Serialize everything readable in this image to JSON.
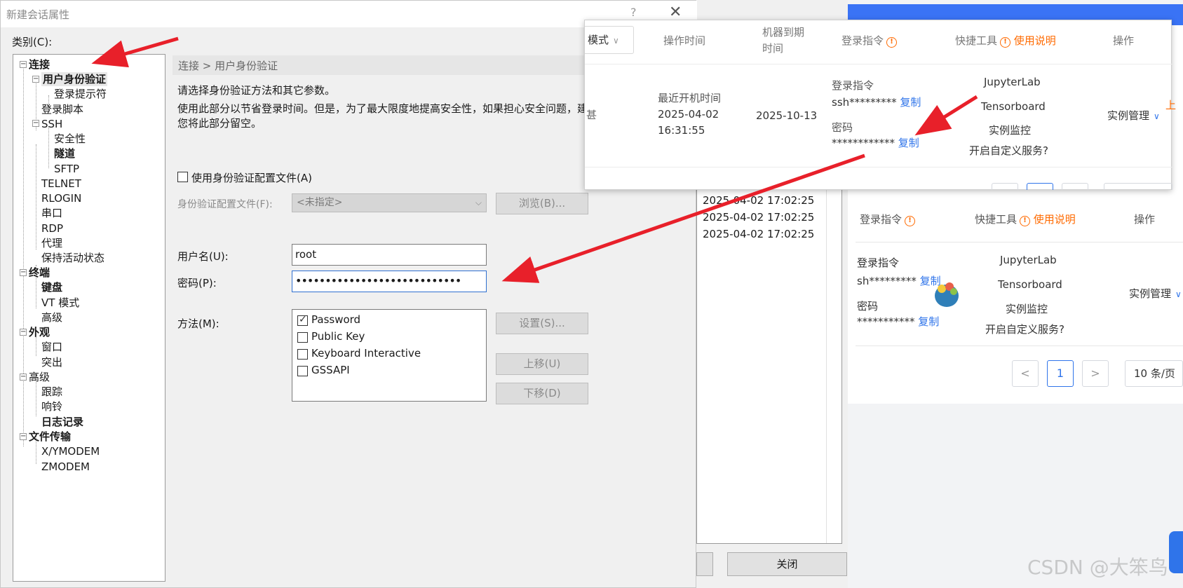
{
  "dialog": {
    "title": "新建会话属性",
    "help_icon": "?",
    "close_icon": "✕",
    "category_label": "类别(C):",
    "tree": [
      {
        "label": "连接",
        "bold": true
      },
      {
        "label": "用户身份验证",
        "bold": true
      },
      {
        "label": "登录提示符"
      },
      {
        "label": "登录脚本"
      },
      {
        "label": "SSH"
      },
      {
        "label": "安全性"
      },
      {
        "label": "隧道",
        "bold": true
      },
      {
        "label": "SFTP"
      },
      {
        "label": "TELNET"
      },
      {
        "label": "RLOGIN"
      },
      {
        "label": "串口"
      },
      {
        "label": "RDP"
      },
      {
        "label": "代理"
      },
      {
        "label": "保持活动状态"
      },
      {
        "label": "终端",
        "bold": true
      },
      {
        "label": "键盘",
        "bold": true
      },
      {
        "label": "VT 模式"
      },
      {
        "label": "高级"
      },
      {
        "label": "外观",
        "bold": true
      },
      {
        "label": "窗口"
      },
      {
        "label": "突出"
      },
      {
        "label": "高级"
      },
      {
        "label": "跟踪"
      },
      {
        "label": "响铃"
      },
      {
        "label": "日志记录",
        "bold": true
      },
      {
        "label": "文件传输",
        "bold": true
      },
      {
        "label": "X/YMODEM"
      },
      {
        "label": "ZMODEM"
      }
    ],
    "breadcrumb": "连接 > 用户身份验证",
    "desc1": "请选择身份验证方法和其它参数。",
    "desc2": "使用此部分以节省登录时间。但是，为了最大限度地提高安全性，如果担心安全问题，建议您将此部分留空。",
    "use_profile_label": "使用身份验证配置文件(A)",
    "profile_file_label": "身份验证配置文件(F):",
    "profile_file_value": "<未指定>",
    "browse_button": "浏览(B)...",
    "username_label": "用户名(U):",
    "username_value": "root",
    "password_label": "密码(P):",
    "password_value": "••••••••••••••••••••••••••••",
    "method_label": "方法(M):",
    "methods": [
      {
        "label": "Password",
        "checked": true
      },
      {
        "label": "Public Key",
        "checked": false
      },
      {
        "label": "Keyboard Interactive",
        "checked": false
      },
      {
        "label": "GSSAPI",
        "checked": false
      }
    ],
    "settings_button": "设置(S)...",
    "move_up_button": "上移(U)",
    "move_down_button": "下移(D)"
  },
  "mid_window": {
    "timestamps": [
      "2025-04-02 17:02:25",
      "2025-04-02 17:02:25",
      "2025-04-02 17:02:25"
    ],
    "close_button": "关闭"
  },
  "popup": {
    "mode_select": "模式",
    "col_op_time": "操作时间",
    "col_expire_line1": "机器到期",
    "col_expire_line2": "时间",
    "col_login_cmd": "登录指令",
    "col_tools": "快捷工具",
    "usage_link": "使用说明",
    "col_actions": "操作",
    "partial_char": "甚",
    "last_boot_label": "最近开机时间",
    "last_boot_date": "2025-04-02",
    "last_boot_time": "16:31:55",
    "expire_date": "2025-10-13",
    "login_cmd_label": "登录指令",
    "login_cmd_value": "ssh*********",
    "copy1": "复制",
    "password_label": "密码",
    "password_value": "************",
    "copy2": "复制",
    "tool_jupyter": "JupyterLab",
    "tool_tensorboard": "Tensorboard",
    "tool_monitor": "实例监控",
    "tool_custom": "开启自定义服务?",
    "manage": "实例管理",
    "edge_char": "上"
  },
  "background_page": {
    "col_login_cmd": "登录指令",
    "col_tools": "快捷工具",
    "usage_link": "使用说明",
    "col_actions": "操作",
    "login_cmd_label": "登录指令",
    "login_cmd_value": "sh*********",
    "copy1": "复制",
    "password_label": "密码",
    "password_value": "***********",
    "copy2": "复制",
    "tool_jupyter": "JupyterLab",
    "tool_tensorboard": "Tensorboard",
    "tool_monitor": "实例监控",
    "tool_custom": "开启自定义服务?",
    "manage": "实例管理",
    "page_prev": "<",
    "page_current": "1",
    "page_next": ">",
    "page_size": "10 条/页"
  },
  "watermark": "CSDN @大笨鸟",
  "colors": {
    "accent_blue": "#2f74ea",
    "warn_orange": "#ff6a00",
    "arrow_red": "#e8202a"
  }
}
